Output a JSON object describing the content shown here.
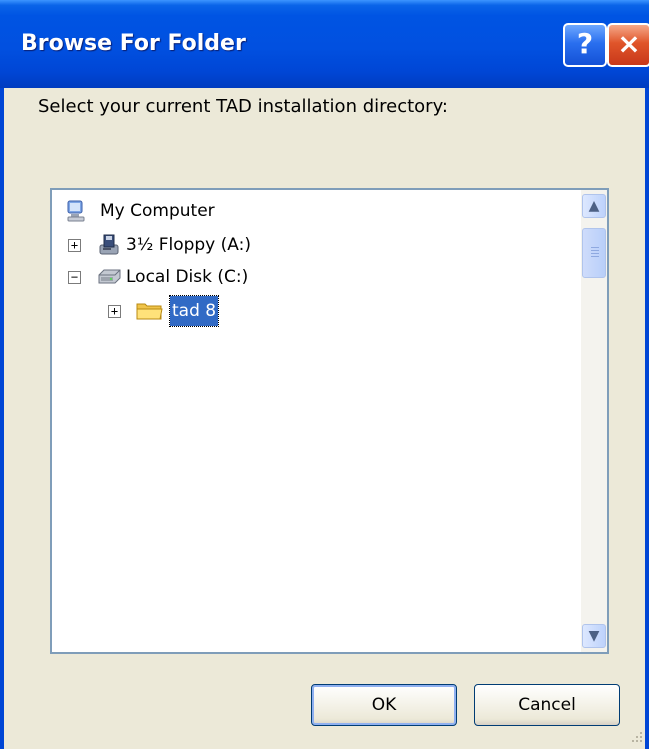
{
  "window": {
    "title": "Browse For Folder",
    "help_glyph": "?",
    "close_glyph": "×",
    "titlebar_color": "#0054e3"
  },
  "dialog": {
    "prompt": "Select your current TAD installation directory:"
  },
  "tree": {
    "items": [
      {
        "label": "My Computer",
        "icon": "my-computer-icon",
        "expander": ""
      },
      {
        "label": "3½ Floppy (A:)",
        "icon": "floppy-drive-icon",
        "expander": "+"
      },
      {
        "label": "Local Disk (C:)",
        "icon": "hard-disk-icon",
        "expander": "−"
      },
      {
        "label": "tad 8",
        "icon": "folder-icon",
        "expander": "+",
        "selected": true
      }
    ],
    "selection_color": "#316ac5"
  },
  "scrollbar": {
    "up_arrow": "▲",
    "down_arrow": "▼"
  },
  "buttons": {
    "ok_label": "OK",
    "cancel_label": "Cancel"
  }
}
